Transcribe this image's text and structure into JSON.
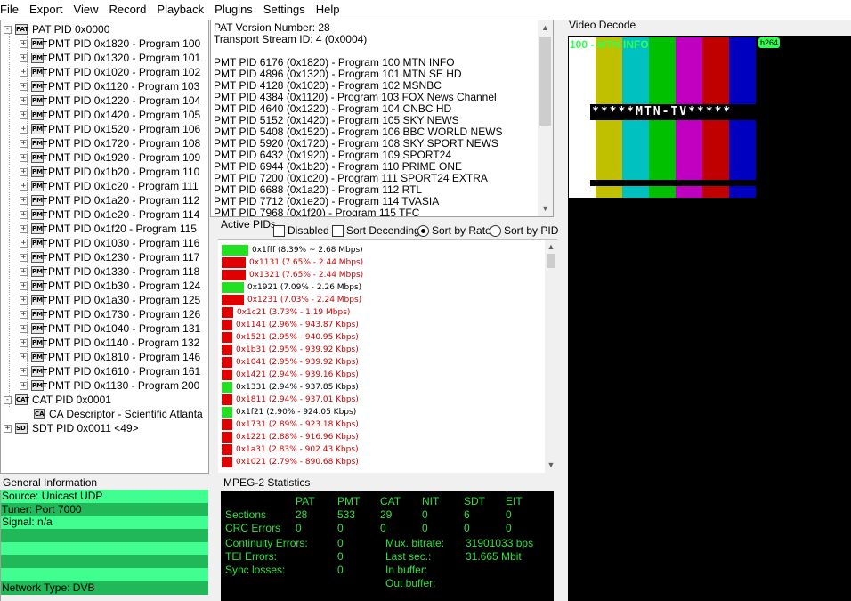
{
  "menu": [
    "File",
    "Export",
    "View",
    "Record",
    "Playback",
    "Plugins",
    "Settings",
    "Help"
  ],
  "tree": {
    "pat": "PAT PID 0x0000",
    "pmts": [
      "PMT PID 0x1820 - Program 100",
      "PMT PID 0x1320 - Program 101",
      "PMT PID 0x1020 - Program 102",
      "PMT PID 0x1120 - Program 103",
      "PMT PID 0x1220 - Program 104",
      "PMT PID 0x1420 - Program 105",
      "PMT PID 0x1520 - Program 106",
      "PMT PID 0x1720 - Program 108",
      "PMT PID 0x1920 - Program 109",
      "PMT PID 0x1b20 - Program 110",
      "PMT PID 0x1c20 - Program 111",
      "PMT PID 0x1a20 - Program 112",
      "PMT PID 0x1e20 - Program 114",
      "PMT PID 0x1f20 - Program 115",
      "PMT PID 0x1030 - Program 116",
      "PMT PID 0x1230 - Program 117",
      "PMT PID 0x1330 - Program 118",
      "PMT PID 0x1b30 - Program 124",
      "PMT PID 0x1a30 - Program 125",
      "PMT PID 0x1730 - Program 126",
      "PMT PID 0x1040 - Program 131",
      "PMT PID 0x1140 - Program 132",
      "PMT PID 0x1810 - Program 146",
      "PMT PID 0x1610 - Program 161",
      "PMT PID 0x1130 - Program 200"
    ],
    "cat": "CAT PID 0x0001",
    "ca_descriptor": "CA Descriptor - Scientific Atlanta",
    "sdt": "SDT PID 0x0011 <49>",
    "icon_pmt": "PMT",
    "icon_ca": "CA"
  },
  "info_lines": [
    "PAT Version Number: 28",
    "Transport Stream ID: 4 (0x0004)",
    "",
    "PMT PID 6176 (0x1820) - Program 100 MTN INFO",
    "PMT PID 4896 (0x1320) - Program 101 MTN SE HD",
    "PMT PID 4128 (0x1020) - Program 102 MSNBC",
    "PMT PID 4384 (0x1120) - Program 103 FOX News Channel",
    "PMT PID 4640 (0x1220) - Program 104 CNBC HD",
    "PMT PID 5152 (0x1420) - Program 105 SKY NEWS",
    "PMT PID 5408 (0x1520) - Program 106 BBC WORLD NEWS",
    "PMT PID 5920 (0x1720) - Program 108 SKY SPORT NEWS",
    "PMT PID 6432 (0x1920) - Program 109 SPORT24",
    "PMT PID 6944 (0x1b20) - Program 110 PRIME ONE",
    "PMT PID 7200 (0x1c20) - Program 111 SPORT24 EXTRA",
    "PMT PID 6688 (0x1a20) - Program 112 RTL",
    "PMT PID 7712 (0x1e20) - Program 114 TVASIA",
    "PMT PID 7968 (0x1f20) - Program 115 TFC"
  ],
  "active_pids": {
    "label": "Active PIDs",
    "disabled": "Disabled",
    "sort_desc": "Sort Decending",
    "sort_rate": "Sort by Rate",
    "sort_pid": "Sort by PID",
    "rows": [
      {
        "text": "0x1fff (8.39% ~ 2.68 Mbps)",
        "color": "#22e022",
        "bar_pct": 8.39,
        "red": false
      },
      {
        "text": "0x1131 (7.65% - 2.44 Mbps)",
        "color": "#e00000",
        "bar_pct": 7.65,
        "red": true
      },
      {
        "text": "0x1321 (7.65% - 2.44 Mbps)",
        "color": "#e00000",
        "bar_pct": 7.65,
        "red": true
      },
      {
        "text": "0x1921 (7.09% - 2.26 Mbps)",
        "color": "#22e022",
        "bar_pct": 7.09,
        "red": false
      },
      {
        "text": "0x1231 (7.03% - 2.24 Mbps)",
        "color": "#e00000",
        "bar_pct": 7.03,
        "red": true
      },
      {
        "text": "0x1c21 (3.73% - 1.19 Mbps)",
        "color": "#e00000",
        "bar_pct": 3.73,
        "red": true
      },
      {
        "text": "0x1141 (2.96% - 943.87 Kbps)",
        "color": "#e00000",
        "bar_pct": 2.96,
        "red": true
      },
      {
        "text": "0x1521 (2.95% - 940.95 Kbps)",
        "color": "#e00000",
        "bar_pct": 2.95,
        "red": true
      },
      {
        "text": "0x1b31 (2.95% - 939.92 Kbps)",
        "color": "#e00000",
        "bar_pct": 2.95,
        "red": true
      },
      {
        "text": "0x1041 (2.95% - 939.92 Kbps)",
        "color": "#e00000",
        "bar_pct": 2.95,
        "red": true
      },
      {
        "text": "0x1421 (2.94% - 939.16 Kbps)",
        "color": "#e00000",
        "bar_pct": 2.94,
        "red": true
      },
      {
        "text": "0x1331 (2.94% - 937.85 Kbps)",
        "color": "#22e022",
        "bar_pct": 2.94,
        "red": false
      },
      {
        "text": "0x1811 (2.94% - 937.01 Kbps)",
        "color": "#e00000",
        "bar_pct": 2.94,
        "red": true
      },
      {
        "text": "0x1f21 (2.90% - 924.05 Kbps)",
        "color": "#22e022",
        "bar_pct": 2.9,
        "red": false
      },
      {
        "text": "0x1731 (2.89% - 923.18 Kbps)",
        "color": "#e00000",
        "bar_pct": 2.89,
        "red": true
      },
      {
        "text": "0x1221 (2.88% - 916.96 Kbps)",
        "color": "#e00000",
        "bar_pct": 2.88,
        "red": true
      },
      {
        "text": "0x1a31 (2.83% - 902.43 Kbps)",
        "color": "#e00000",
        "bar_pct": 2.83,
        "red": true
      },
      {
        "text": "0x1021 (2.79% - 890.68 Kbps)",
        "color": "#e00000",
        "bar_pct": 2.79,
        "red": true
      }
    ]
  },
  "general_info": {
    "label": "General Information",
    "rows": [
      "Source: Unicast UDP",
      "Tuner: Port 7000",
      "Signal: n/a",
      "",
      "",
      "",
      "",
      "Network Type: DVB"
    ]
  },
  "stats": {
    "label": "MPEG-2 Statistics",
    "headers": [
      "PAT",
      "PMT",
      "CAT",
      "NIT",
      "SDT",
      "EIT"
    ],
    "sections_label": "Sections",
    "sections": [
      "28",
      "533",
      "29",
      "0",
      "6",
      "0"
    ],
    "crc_label": "CRC Errors",
    "crc": [
      "0",
      "0",
      "0",
      "0",
      "0",
      "0"
    ],
    "continuity_label": "Continuity Errors:",
    "continuity": "0",
    "tei_label": "TEI Errors:",
    "tei": "0",
    "sync_label": "Sync losses:",
    "sync": "0",
    "mux_label": "Mux. bitrate:",
    "mux": "31901033 bps",
    "last_label": "Last sec.:",
    "last": "31.665 Mbit",
    "inbuf_label": "In buffer:",
    "outbuf_label": "Out buffer:"
  },
  "video": {
    "label": "Video Decode",
    "channel": "100 - MTN INFO",
    "codec": "h264",
    "overlay": "*****MTN-TV*****",
    "bar_colors": [
      "#ffffff",
      "#c0c000",
      "#00c0c0",
      "#00c000",
      "#c000c0",
      "#c00000",
      "#0000c0"
    ]
  }
}
